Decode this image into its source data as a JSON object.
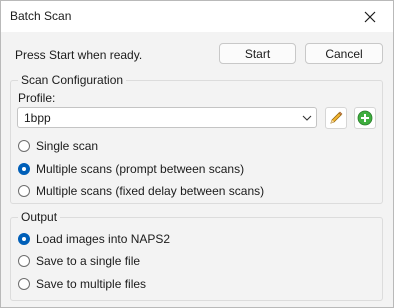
{
  "window": {
    "title": "Batch Scan",
    "close_icon": "close-icon"
  },
  "status_text": "Press Start when ready.",
  "buttons": {
    "start": "Start",
    "cancel": "Cancel"
  },
  "scan_config": {
    "title": "Scan Configuration",
    "profile_label": "Profile:",
    "profile_value": "1bpp",
    "edit_icon": "pencil-icon",
    "add_icon": "plus-icon",
    "options": [
      {
        "label": "Single scan",
        "checked": false
      },
      {
        "label": "Multiple scans (prompt between scans)",
        "checked": true
      },
      {
        "label": "Multiple scans (fixed delay between scans)",
        "checked": false
      }
    ]
  },
  "output": {
    "title": "Output",
    "options": [
      {
        "label": "Load images into NAPS2",
        "checked": true
      },
      {
        "label": "Save to a single file",
        "checked": false
      },
      {
        "label": "Save to multiple files",
        "checked": false
      }
    ]
  },
  "colors": {
    "accent": "#005fb8",
    "background": "#f3f3f3",
    "titlebar": "#ffffff"
  }
}
